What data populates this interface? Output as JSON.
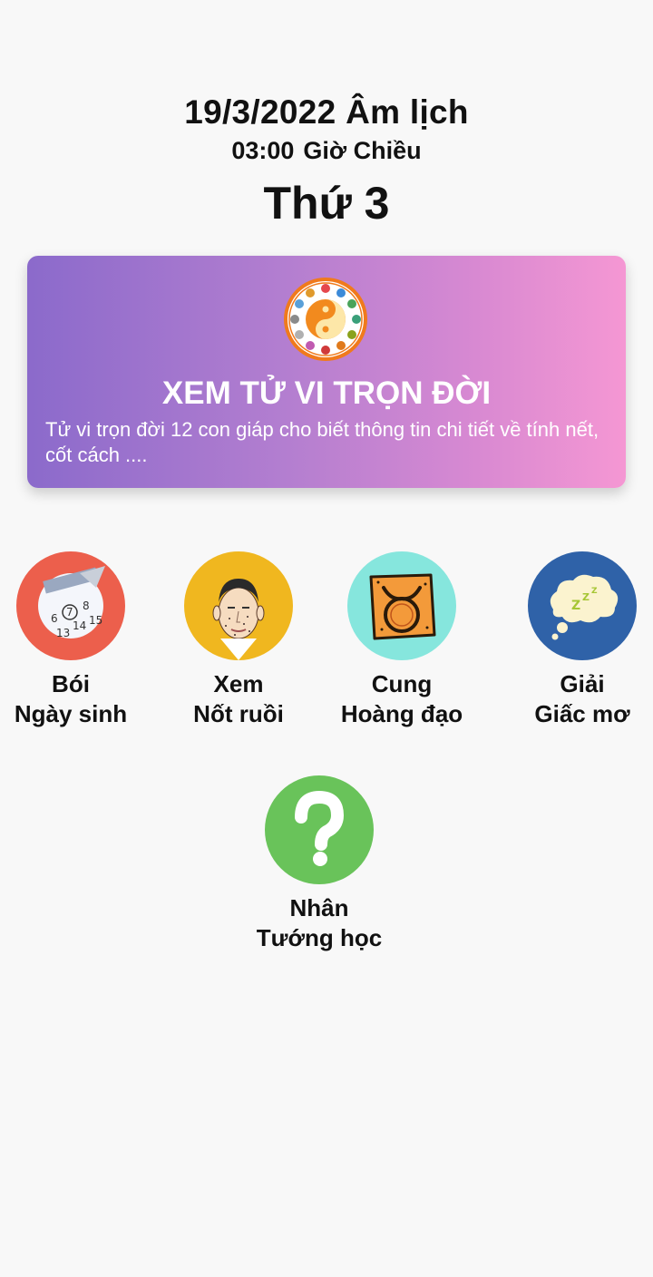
{
  "header": {
    "lunar_date": "19/3/2022 Âm lịch",
    "time": "03:00",
    "period": "Giờ Chiều",
    "weekday": "Thứ 3"
  },
  "banner": {
    "title": "XEM TỬ VI TRỌN ĐỜI",
    "description": "Tử vi trọn đời 12 con giáp cho biết thông tin chi tiết về tính nết, cốt cách ....",
    "icon": "yin-yang-zodiac-wheel"
  },
  "features": [
    {
      "line1": "Bói",
      "line2": "Ngày sinh",
      "icon": "calendar-icon",
      "color": "#ec5f4c"
    },
    {
      "line1": "Xem",
      "line2": "Nốt ruồi",
      "icon": "face-moles-icon",
      "color": "#f0b71f"
    },
    {
      "line1": "Cung",
      "line2": "Hoàng đạo",
      "icon": "taurus-zodiac-icon",
      "color": "#86e6dd"
    },
    {
      "line1": "Giải",
      "line2": "Giấc mơ",
      "icon": "dream-cloud-icon",
      "color": "#2f62a8"
    },
    {
      "line1": "Nhân",
      "line2": "Tướng học",
      "icon": "question-mark-icon",
      "color": "#69c35a"
    }
  ],
  "colors": {
    "banner_gradient_start": "#8b6acb",
    "banner_gradient_end": "#f597d3",
    "background": "#f8f8f8"
  }
}
